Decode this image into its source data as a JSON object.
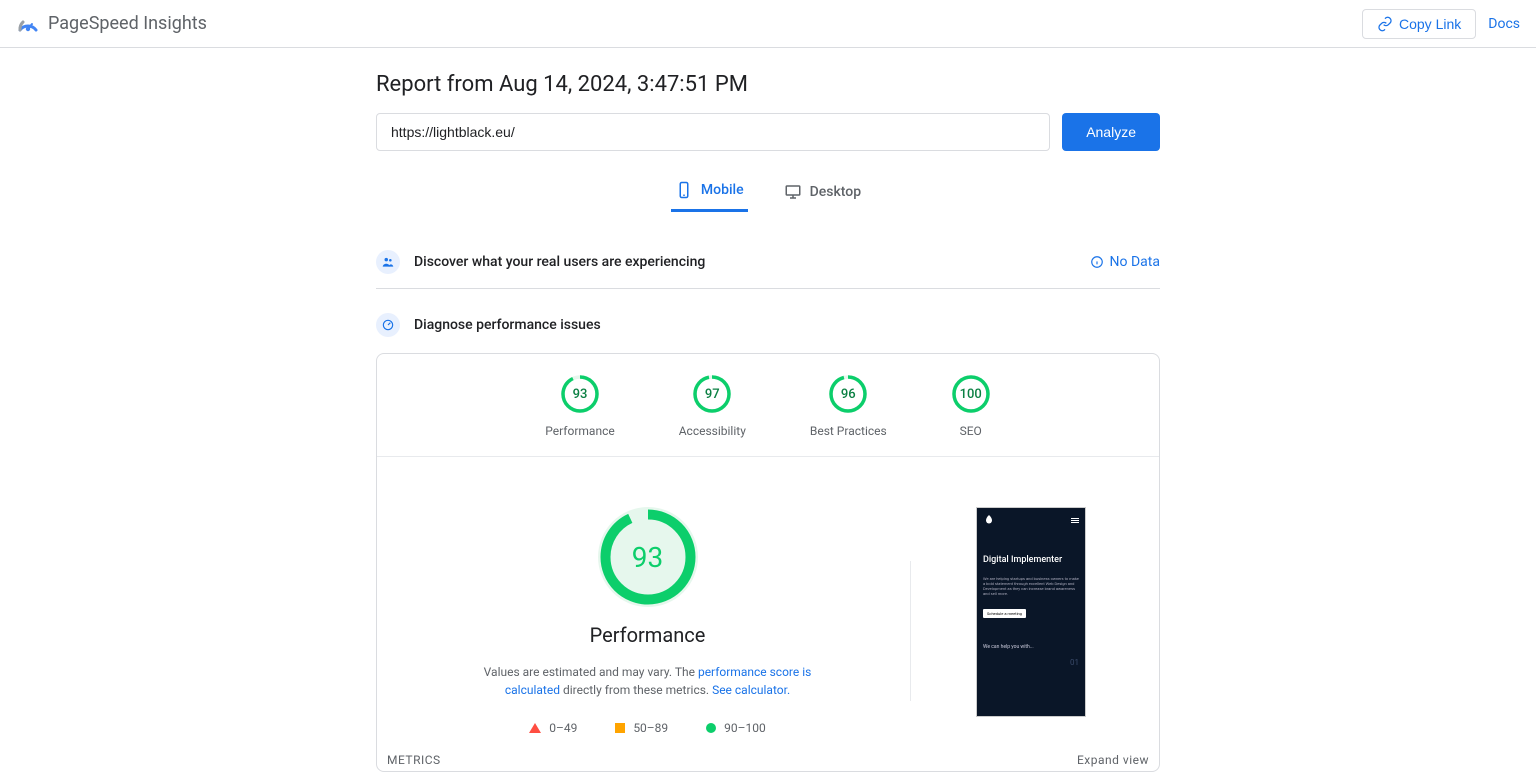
{
  "header": {
    "app_name": "PageSpeed Insights",
    "copy_link": "Copy Link",
    "docs": "Docs"
  },
  "report": {
    "title": "Report from Aug 14, 2024, 3:47:51 PM",
    "url_value": "https://lightblack.eu/",
    "analyze": "Analyze"
  },
  "tabs": {
    "mobile": "Mobile",
    "desktop": "Desktop"
  },
  "sections": {
    "discover": "Discover what your real users are experiencing",
    "no_data": "No Data",
    "diagnose": "Diagnose performance issues"
  },
  "gauges": [
    {
      "score": "93",
      "label": "Performance",
      "pct": 93
    },
    {
      "score": "97",
      "label": "Accessibility",
      "pct": 97
    },
    {
      "score": "96",
      "label": "Best Practices",
      "pct": 96
    },
    {
      "score": "100",
      "label": "SEO",
      "pct": 100
    }
  ],
  "perf": {
    "score": "93",
    "pct": 93,
    "name": "Performance",
    "desc_prefix": "Values are estimated and may vary. The ",
    "desc_link1": "performance score is calculated",
    "desc_mid": " directly from these metrics. ",
    "desc_link2": "See calculator.",
    "legend": {
      "a": "0–49",
      "b": "50–89",
      "c": "90–100"
    }
  },
  "preview": {
    "title": "Digital Implementer",
    "body": "We are helping startups and business owners to make a bold statement through excellent Web Design and Development as they can increase brand awareness and sell more.",
    "button": "Schedule a meeting",
    "foot": "We can help you with...",
    "num": "01"
  },
  "metrics": {
    "label": "METRICS",
    "expand": "Expand view"
  },
  "colors": {
    "green": "#0cce6b"
  }
}
